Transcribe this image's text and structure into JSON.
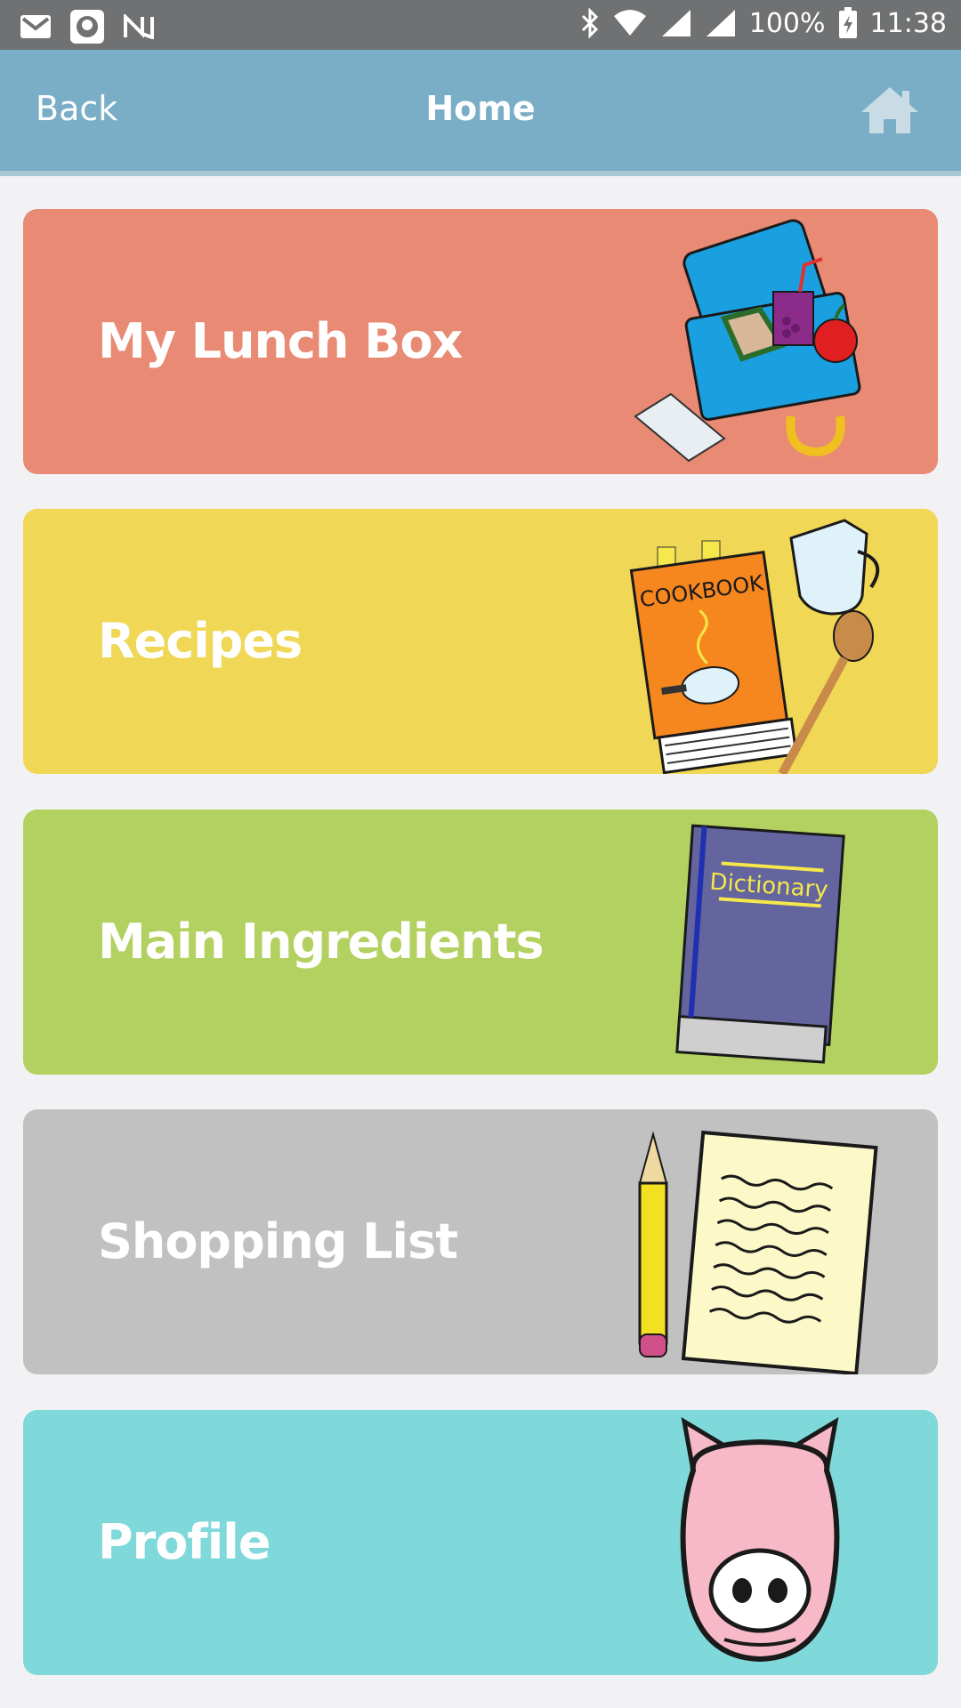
{
  "status_bar": {
    "battery": "100%",
    "time": "11:38",
    "icons": [
      "gmail-icon",
      "app-icon",
      "n-icon",
      "bluetooth-icon",
      "wifi-icon",
      "signal-r-icon",
      "signal-icon",
      "battery-charging-icon"
    ]
  },
  "header": {
    "back_label": "Back",
    "title": "Home",
    "home_icon": "home-icon"
  },
  "menu": {
    "items": [
      {
        "label": "My Lunch Box",
        "color": "#e88a74",
        "icon": "lunchbox-icon"
      },
      {
        "label": "Recipes",
        "color": "#f0d755",
        "icon": "cookbook-icon"
      },
      {
        "label": "Main Ingredients",
        "color": "#b2d160",
        "icon": "dictionary-icon"
      },
      {
        "label": "Shopping List",
        "color": "#c1c1c1",
        "icon": "notepad-pencil-icon"
      },
      {
        "label": "Profile",
        "color": "#7fd8d9",
        "icon": "pig-icon"
      }
    ],
    "cookbook_text": "COOKBOOK",
    "dictionary_text": "Dictionary"
  }
}
